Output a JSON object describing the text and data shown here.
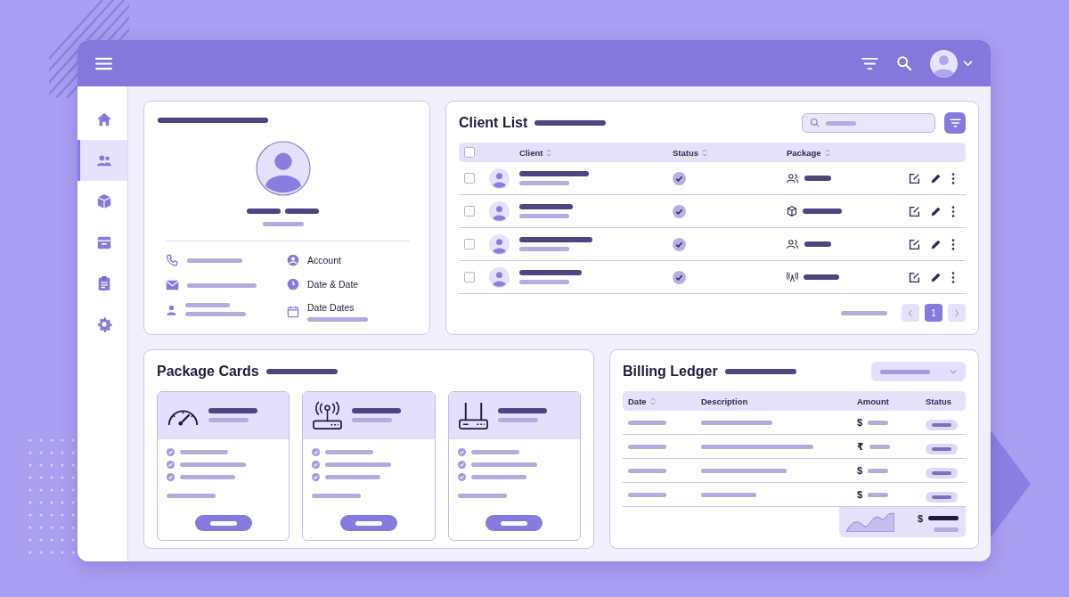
{
  "sidebar": {
    "items": [
      {
        "selected": false
      },
      {
        "selected": true
      },
      {
        "selected": false
      },
      {
        "selected": false
      },
      {
        "selected": false
      },
      {
        "selected": false
      }
    ]
  },
  "profile_card": {
    "details": [
      {
        "label": "Account"
      },
      {
        "label": "Date & Date"
      },
      {
        "label": "Date Dates"
      }
    ]
  },
  "client_list": {
    "title": "Client List",
    "header_checkbox": {
      "checked": false
    },
    "columns": [
      {
        "label": "Client",
        "sortable": true
      },
      {
        "label": "Status",
        "sortable": true
      },
      {
        "label": "Package",
        "sortable": true
      }
    ],
    "rows": [
      {
        "checked": false,
        "verified": true,
        "kind": "group"
      },
      {
        "checked": false,
        "verified": true,
        "kind": "box"
      },
      {
        "checked": false,
        "verified": true,
        "kind": "group"
      },
      {
        "checked": false,
        "verified": true,
        "kind": "antenna"
      }
    ],
    "pagination": {
      "pages": [
        {
          "label": "1",
          "selected": true
        }
      ]
    }
  },
  "package_cards": {
    "title": "Package Cards",
    "cards": [
      {
        "kind": "speedometer"
      },
      {
        "kind": "antenna"
      },
      {
        "kind": "router"
      }
    ]
  },
  "billing_ledger": {
    "title": "Billing Ledger",
    "columns": [
      {
        "label": "Date",
        "sortable": true
      },
      {
        "label": "Description",
        "sortable": false
      },
      {
        "label": "Amount",
        "sortable": false
      },
      {
        "label": "Status",
        "sortable": false
      }
    ],
    "rows": [
      {
        "currency": "$"
      },
      {
        "currency": "₹"
      },
      {
        "currency": "$"
      },
      {
        "currency": "$"
      }
    ],
    "summary": {
      "currency": "$"
    }
  }
}
